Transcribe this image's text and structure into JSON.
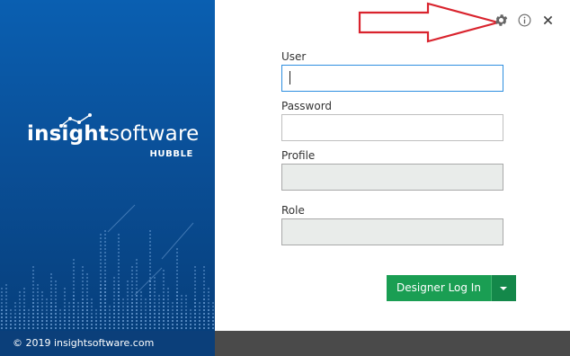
{
  "brand": {
    "wordmark_bold": "insight",
    "wordmark_light": "software",
    "product": "HUBBLE",
    "copyright": "© 2019 insightsoftware.com",
    "panel_color": "#0a5fb1"
  },
  "toolbar": {
    "settings_icon": "gear-icon",
    "info_icon": "info-icon",
    "close_icon": "close-icon",
    "annotation_color": "#d9232d"
  },
  "form": {
    "user_label": "User",
    "user_value": "",
    "password_label": "Password",
    "password_value": "",
    "profile_label": "Profile",
    "profile_value": "",
    "role_label": "Role",
    "role_value": ""
  },
  "actions": {
    "login_label": "Designer Log In",
    "dropdown_icon": "caret-down-icon",
    "accent": "#1a9e53"
  }
}
